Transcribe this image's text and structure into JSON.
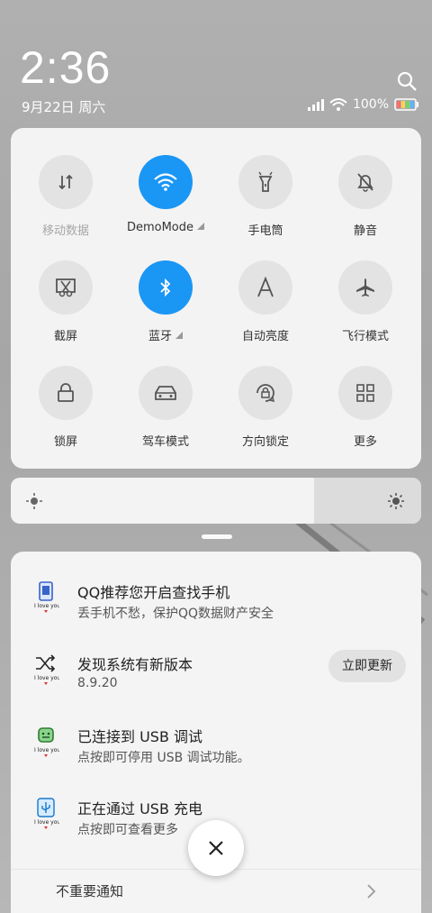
{
  "status": {
    "time": "2:36",
    "date": "9月22日 周六",
    "battery": "100%"
  },
  "quick_settings": {
    "tiles": [
      {
        "label": "移动数据",
        "icon": "mobile-data-icon",
        "active": false,
        "dim": true
      },
      {
        "label": "DemoMode",
        "icon": "wifi-icon",
        "active": true,
        "more": true
      },
      {
        "label": "手电筒",
        "icon": "flashlight-icon",
        "active": false
      },
      {
        "label": "静音",
        "icon": "mute-bell-icon",
        "active": false
      },
      {
        "label": "截屏",
        "icon": "screenshot-icon",
        "active": false
      },
      {
        "label": "蓝牙",
        "icon": "bluetooth-icon",
        "active": true,
        "more": true
      },
      {
        "label": "自动亮度",
        "icon": "auto-brightness-icon",
        "active": false
      },
      {
        "label": "飞行模式",
        "icon": "airplane-icon",
        "active": false
      },
      {
        "label": "锁屏",
        "icon": "lock-icon",
        "active": false
      },
      {
        "label": "驾车模式",
        "icon": "car-icon",
        "active": false
      },
      {
        "label": "方向锁定",
        "icon": "rotation-lock-icon",
        "active": false
      },
      {
        "label": "更多",
        "icon": "grid-icon",
        "active": false
      }
    ],
    "accent": "#1a96f5"
  },
  "brightness": {
    "level": 0.26
  },
  "notifications": [
    {
      "title": "QQ推荐您开启查找手机",
      "text": "丢手机不愁，保护QQ数据财产安全",
      "icon": "phone-find-icon"
    },
    {
      "title": "发现系统有新版本",
      "text": "8.9.20",
      "icon": "shuffle-icon",
      "action": "立即更新"
    },
    {
      "title": "已连接到 USB 调试",
      "text": "点按即可停用 USB 调试功能。",
      "icon": "android-icon"
    },
    {
      "title": "正在通过 USB 充电",
      "text": "点按即可查看更多",
      "icon": "usb-icon"
    }
  ],
  "notif_badge_text": "I love you",
  "unimportant_label": "不重要通知"
}
